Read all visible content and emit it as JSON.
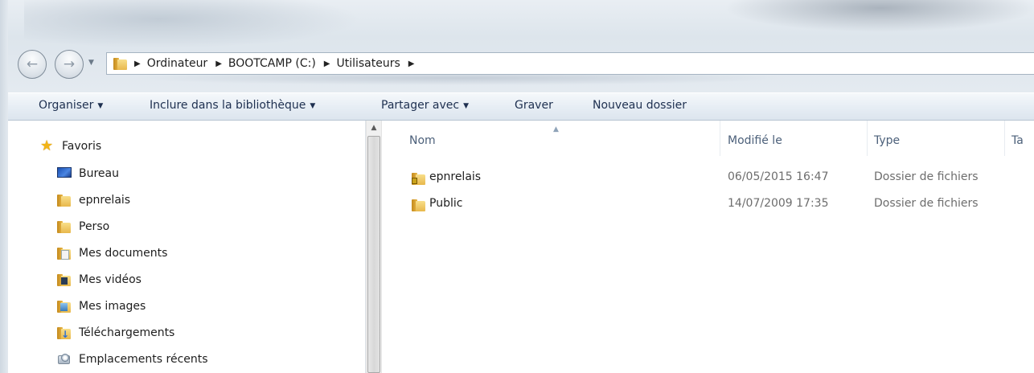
{
  "address_bar": {
    "crumbs": [
      "Ordinateur",
      "BOOTCAMP (C:)",
      "Utilisateurs"
    ]
  },
  "toolbar": {
    "organize": "Organiser",
    "include_library": "Inclure dans la bibliothèque",
    "share_with": "Partager avec",
    "burn": "Graver",
    "new_folder": "Nouveau dossier"
  },
  "navpane": {
    "favorites_label": "Favoris",
    "items": [
      {
        "label": "Bureau",
        "icon": "desktop-icon"
      },
      {
        "label": "epnrelais",
        "icon": "folder-icon"
      },
      {
        "label": "Perso",
        "icon": "folder-icon"
      },
      {
        "label": "Mes documents",
        "icon": "documents-folder-icon"
      },
      {
        "label": "Mes vidéos",
        "icon": "videos-folder-icon"
      },
      {
        "label": "Mes images",
        "icon": "pictures-folder-icon"
      },
      {
        "label": "Téléchargements",
        "icon": "downloads-folder-icon"
      },
      {
        "label": "Emplacements récents",
        "icon": "recent-places-icon"
      }
    ]
  },
  "columns": {
    "name": "Nom",
    "modified": "Modifié le",
    "type": "Type",
    "size_partial": "Ta"
  },
  "files": [
    {
      "name": "epnrelais",
      "modified": "06/05/2015 16:47",
      "type": "Dossier de fichiers",
      "icon": "locked-folder-icon"
    },
    {
      "name": "Public",
      "modified": "14/07/2009 17:35",
      "type": "Dossier de fichiers",
      "icon": "folder-icon"
    }
  ],
  "colors": {
    "toolbar_text": "#1e3050",
    "column_header_text": "#4c607a",
    "secondary_text": "#6d6d6d",
    "folder_yellow": "#e8b84c"
  }
}
